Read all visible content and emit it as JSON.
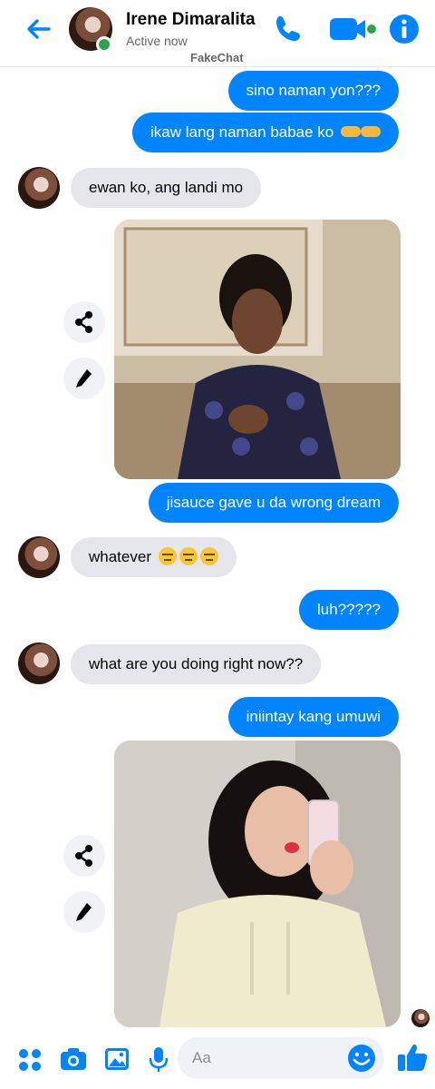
{
  "header": {
    "contact_name": "Irene Dimaralita",
    "status": "Active now",
    "app_name": "FakeChat",
    "icons": [
      "back-arrow-icon",
      "phone-icon",
      "video-camera-icon",
      "info-icon"
    ],
    "accent_color": "#0084ff",
    "online_color": "#31a24c"
  },
  "messages": [
    {
      "direction": "sent",
      "text": "sino naman yon???"
    },
    {
      "direction": "sent",
      "text": "ikaw lang naman babae ko",
      "emoji": "pointing-hands"
    },
    {
      "direction": "received",
      "text": "ewan ko, ang landi mo"
    },
    {
      "direction": "received",
      "type": "photo",
      "description": "photo attachment"
    },
    {
      "direction": "sent",
      "text": "jisauce gave u da wrong dream"
    },
    {
      "direction": "received",
      "text": "whatever",
      "emoji": "unamused-face x3"
    },
    {
      "direction": "sent",
      "text": "luh?????"
    },
    {
      "direction": "received",
      "text": "what are you doing right now??"
    },
    {
      "direction": "sent",
      "text": "iniintay kang umuwi"
    },
    {
      "direction": "received",
      "type": "photo",
      "description": "photo attachment"
    }
  ],
  "composer": {
    "placeholder": "Aa",
    "icons": [
      "apps-grid-icon",
      "camera-icon",
      "image-icon",
      "microphone-icon",
      "emoji-icon",
      "thumbs-up-icon"
    ]
  }
}
